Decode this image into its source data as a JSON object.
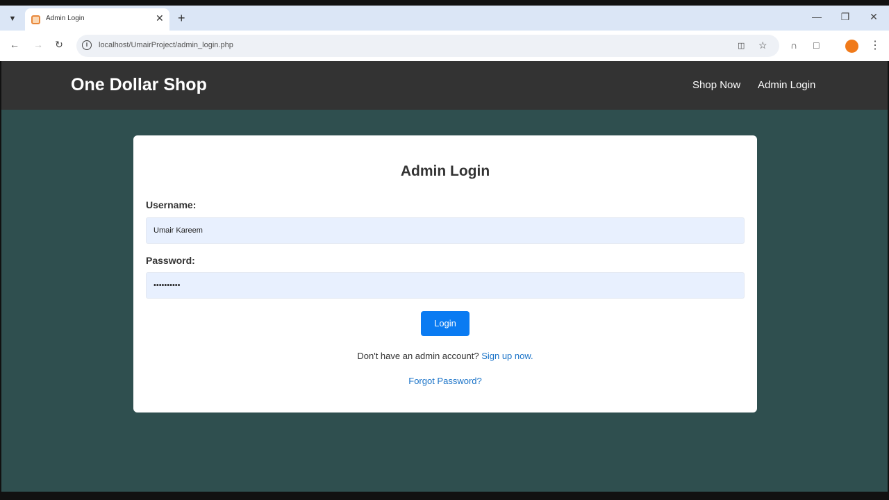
{
  "browser": {
    "tab_title": "Admin Login",
    "new_tab": "+",
    "close_tab": "✕",
    "url": "localhost/UmairProject/admin_login.php"
  },
  "site": {
    "brand": "One Dollar Shop",
    "nav": [
      "Shop Now",
      "Admin Login"
    ]
  },
  "form": {
    "title": "Admin Login",
    "username_label": "Username:",
    "username_value": "Umair Kareem",
    "password_label": "Password:",
    "password_value": "••••••••••",
    "submit_label": "Login",
    "signup_prompt": "Don't have an admin account? ",
    "signup_link": "Sign up now.",
    "forgot_link": "Forgot Password?"
  },
  "colors": {
    "page_bg": "#2f4f4f",
    "header_bg": "#333333",
    "button": "#0a7bf2",
    "link": "#1a73c8"
  }
}
